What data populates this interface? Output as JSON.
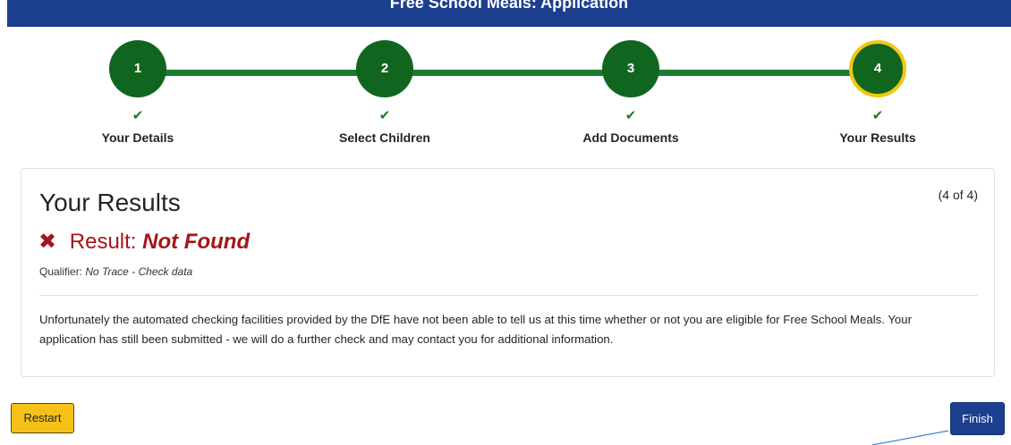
{
  "header": {
    "title": "Free School Meals: Application"
  },
  "steps": [
    {
      "number": "1",
      "label": "Your Details",
      "check": "✔"
    },
    {
      "number": "2",
      "label": "Select Children",
      "check": "✔"
    },
    {
      "number": "3",
      "label": "Add Documents",
      "check": "✔"
    },
    {
      "number": "4",
      "label": "Your Results",
      "check": "✔"
    }
  ],
  "card": {
    "title": "Your Results",
    "counter": "(4 of 4)",
    "result_icon": "✖",
    "result_label": "Result:",
    "result_value": "Not Found",
    "qualifier_label": "Qualifier:",
    "qualifier_value": "No Trace - Check data",
    "message": "Unfortunately the automated checking facilities provided by the DfE have not been able to tell us at this time whether or not you are eligible for Free School Meals. Your application has still been submitted - we will do a further check and may contact you for additional information."
  },
  "actions": {
    "restart_label": "Restart",
    "finish_label": "Finish"
  },
  "colors": {
    "brand_blue": "#1d3f8f",
    "step_green": "#11661f",
    "active_ring": "#f2c811",
    "error_red": "#a4161a",
    "restart_yellow": "#f5c117"
  }
}
